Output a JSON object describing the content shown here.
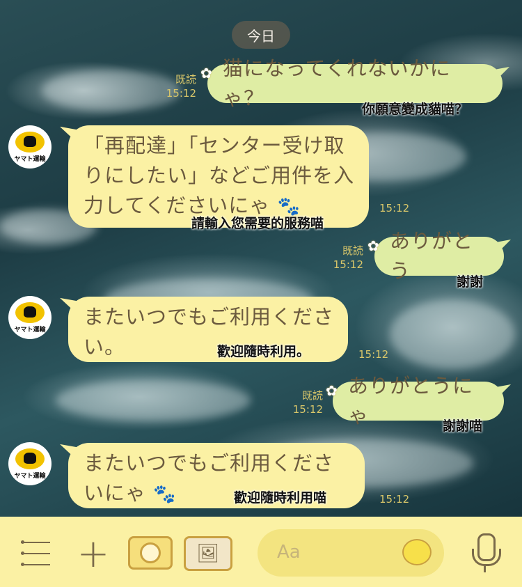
{
  "date_label": "今日",
  "messages": [
    {
      "side": "out",
      "read": "既読",
      "time": "15:12",
      "text": "猫になってくれないかにゃ？",
      "subtitle": "你願意變成貓喵？"
    },
    {
      "side": "in",
      "text": "「再配達」「センター受け取りにしたい」などご用件を入力してくださいにゃ",
      "time": "15:12",
      "subtitle": "請輸入您需要的服務喵"
    },
    {
      "side": "out",
      "read": "既読",
      "time": "15:12",
      "text": "ありがとう",
      "subtitle": "謝謝"
    },
    {
      "side": "in",
      "text": "またいつでもご利用ください。",
      "time": "15:12",
      "subtitle": "歡迎隨時利用。"
    },
    {
      "side": "out",
      "read": "既読",
      "time": "15:12",
      "text": "ありがとうにゃ",
      "subtitle": "謝謝喵"
    },
    {
      "side": "in",
      "text": "またいつでもご利用くださいにゃ",
      "time": "15:12",
      "subtitle": "歡迎隨時利用喵"
    }
  ],
  "avatar_label": "ヤマト運輸",
  "input": {
    "placeholder": "Aa"
  },
  "icons": {
    "menu": "menu-icon",
    "plus": "plus-icon",
    "camera": "camera-icon",
    "photo": "photo-icon",
    "emoji": "lemon-emoji-icon",
    "mic": "microphone-icon"
  },
  "colors": {
    "out_bubble": "#dfeda4",
    "in_bubble": "#fbf1a4",
    "bottom_bar": "#fbf1a4",
    "meta_text": "#d8c66a"
  }
}
